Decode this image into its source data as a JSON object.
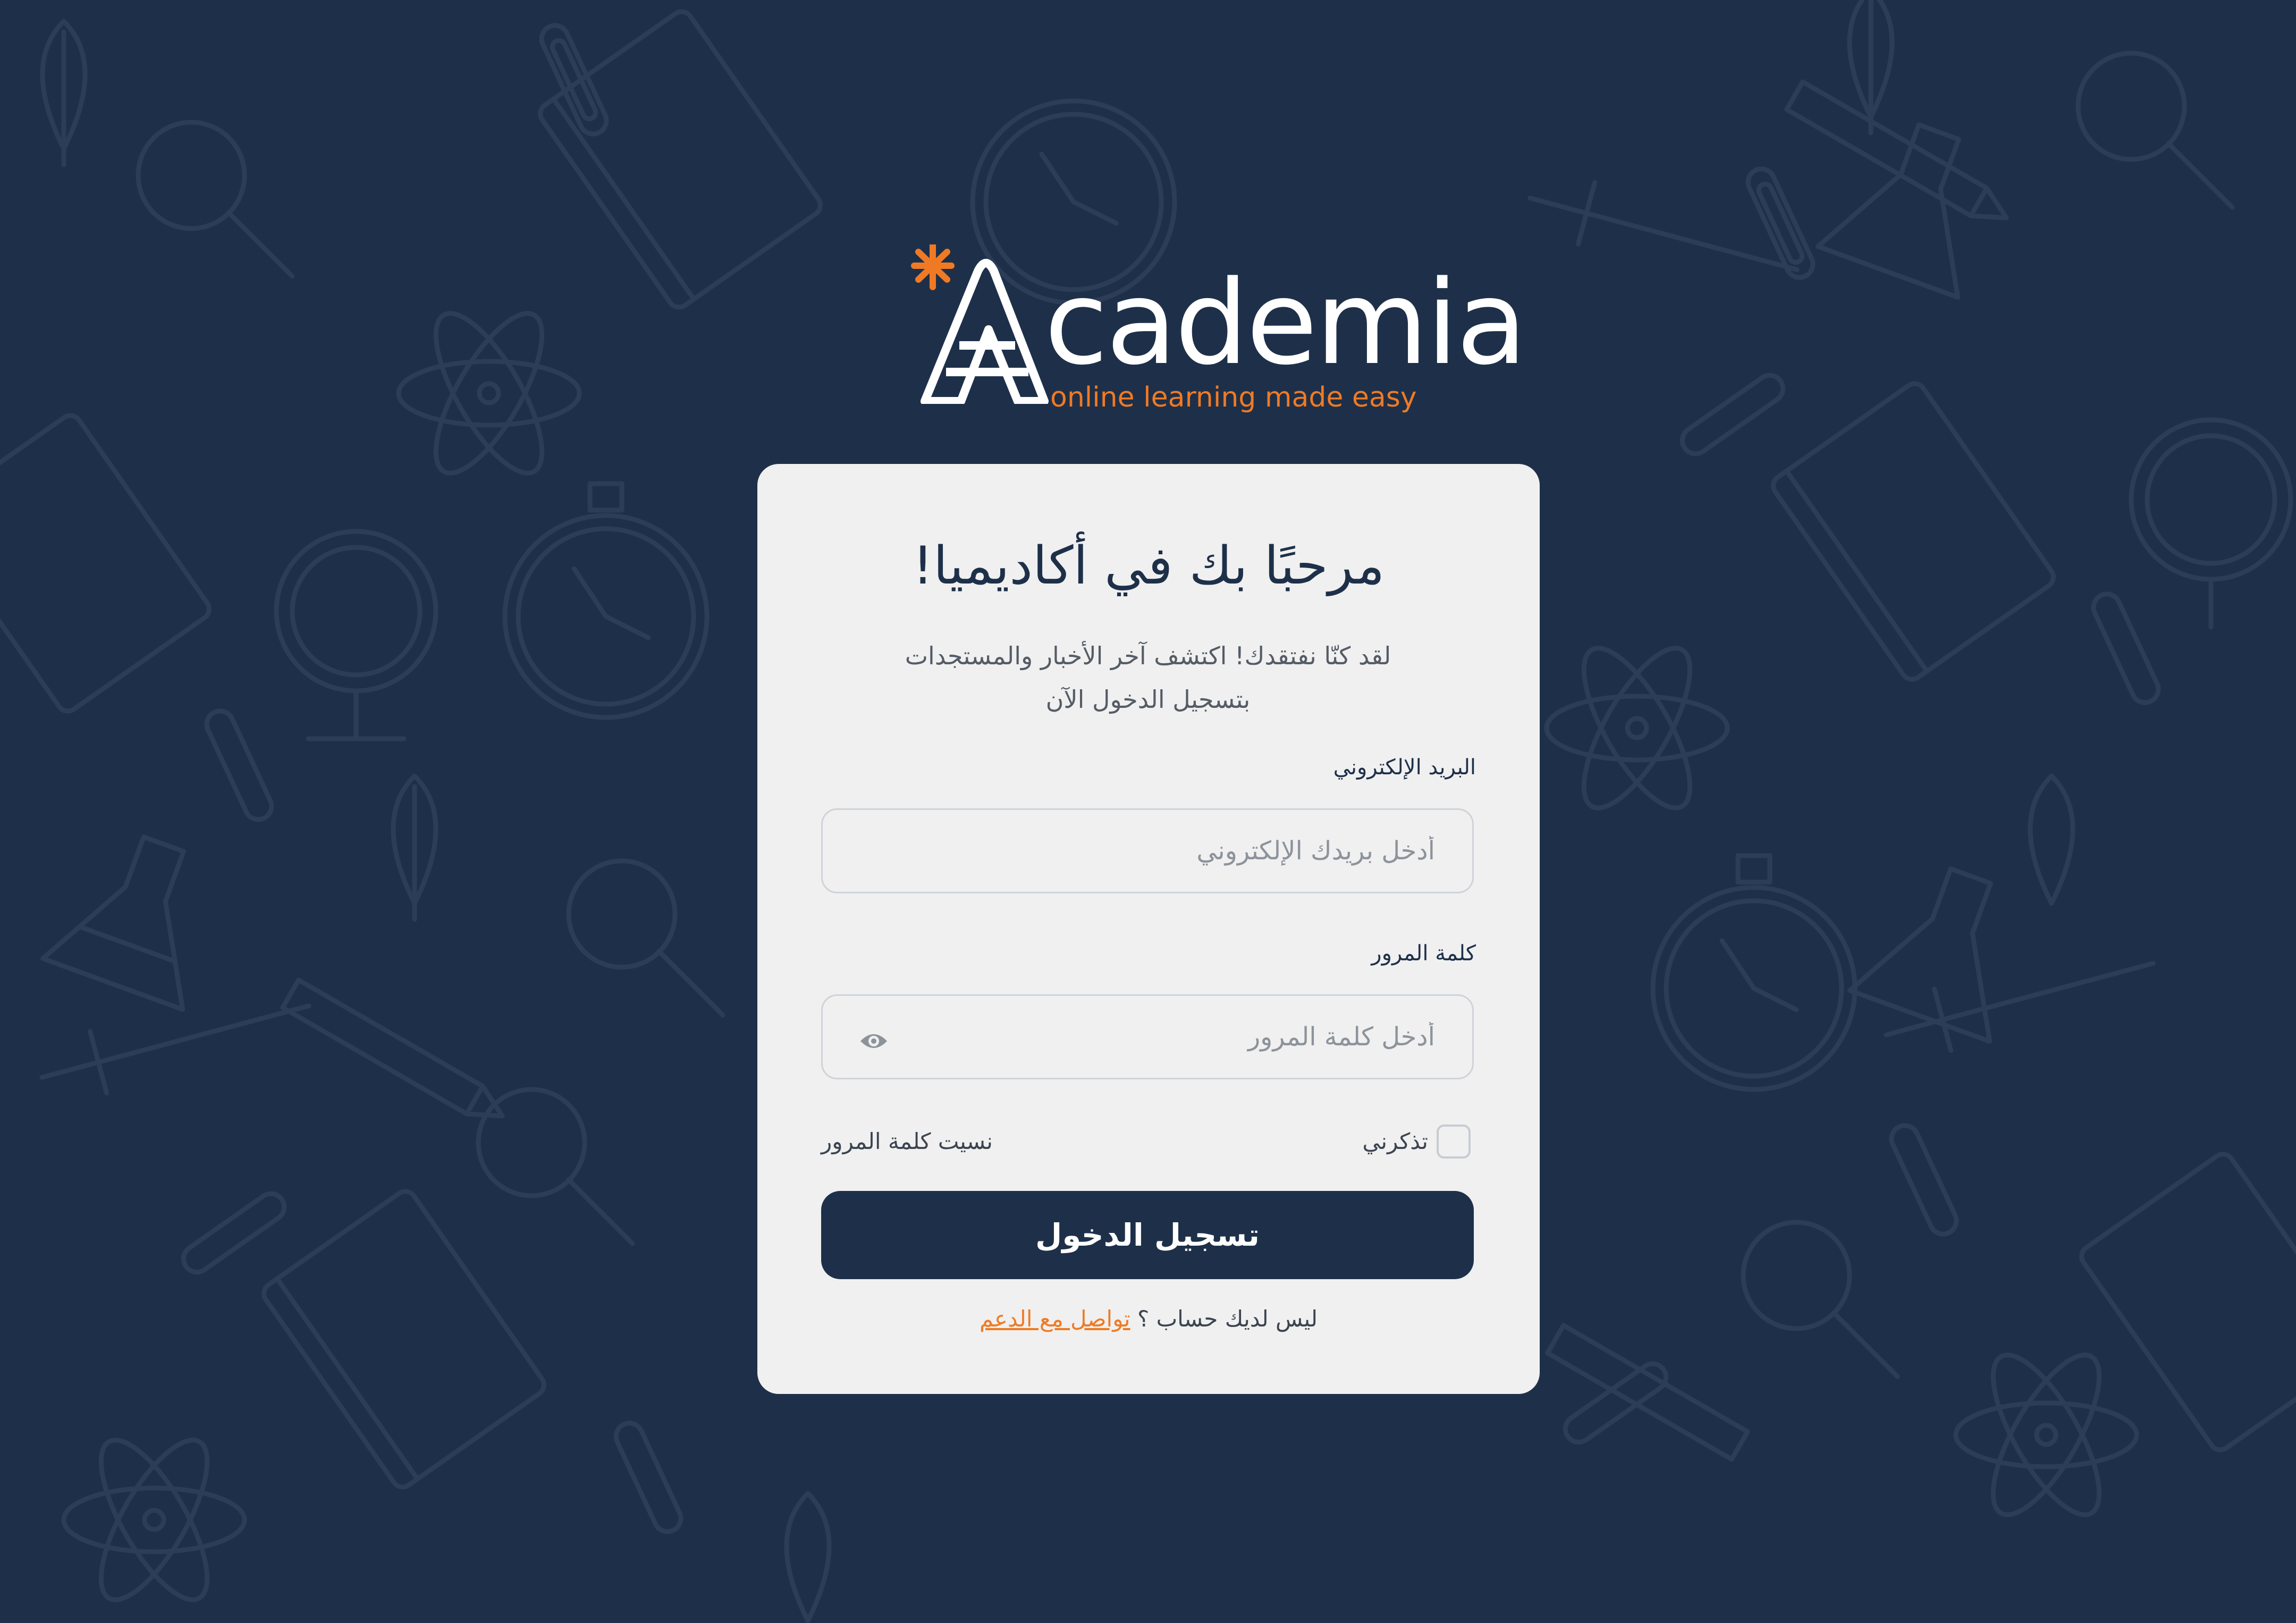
{
  "brand": {
    "name": "Academia",
    "name_rest": "cademia",
    "tagline": "online learning made easy",
    "accent_color": "#f07a24",
    "background_color": "#1e3049"
  },
  "card": {
    "title": "مرحبًا بك في أكاديميا!",
    "subtitle_line1": "لقد كنّا نفتقدك! اكتشف آخر الأخبار والمستجدات",
    "subtitle_line2": "بتسجيل الدخول الآن",
    "email": {
      "label": "البريد الإلكتروني",
      "placeholder": "أدخل بريدك الإلكتروني",
      "value": ""
    },
    "password": {
      "label": "كلمة المرور",
      "placeholder": "أدخل كلمة المرور",
      "value": "",
      "toggle_icon": "eye-icon"
    },
    "remember_label": "تذكرني",
    "remember_checked": false,
    "forgot_label": "نسيت كلمة المرور",
    "submit_label": "تسجيل الدخول",
    "footer_text": "ليس لديك حساب ؟",
    "footer_link": "تواصل مع الدعم"
  }
}
